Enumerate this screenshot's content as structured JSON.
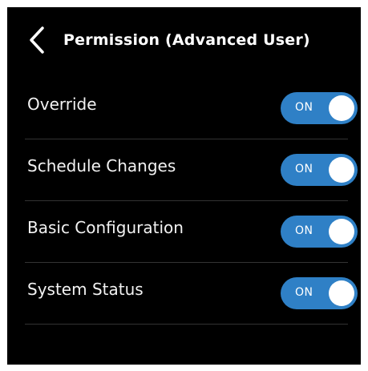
{
  "header": {
    "back_icon": "chevron-left-icon",
    "title": "Permission (Advanced User)"
  },
  "colors": {
    "background": "#000000",
    "toggle_on": "#2f80c6",
    "divider": "#333333"
  },
  "permissions": [
    {
      "label": "Override",
      "state": "ON"
    },
    {
      "label": "Schedule Changes",
      "state": "ON"
    },
    {
      "label": "Basic Configuration",
      "state": "ON"
    },
    {
      "label": "System Status",
      "state": "ON"
    }
  ]
}
